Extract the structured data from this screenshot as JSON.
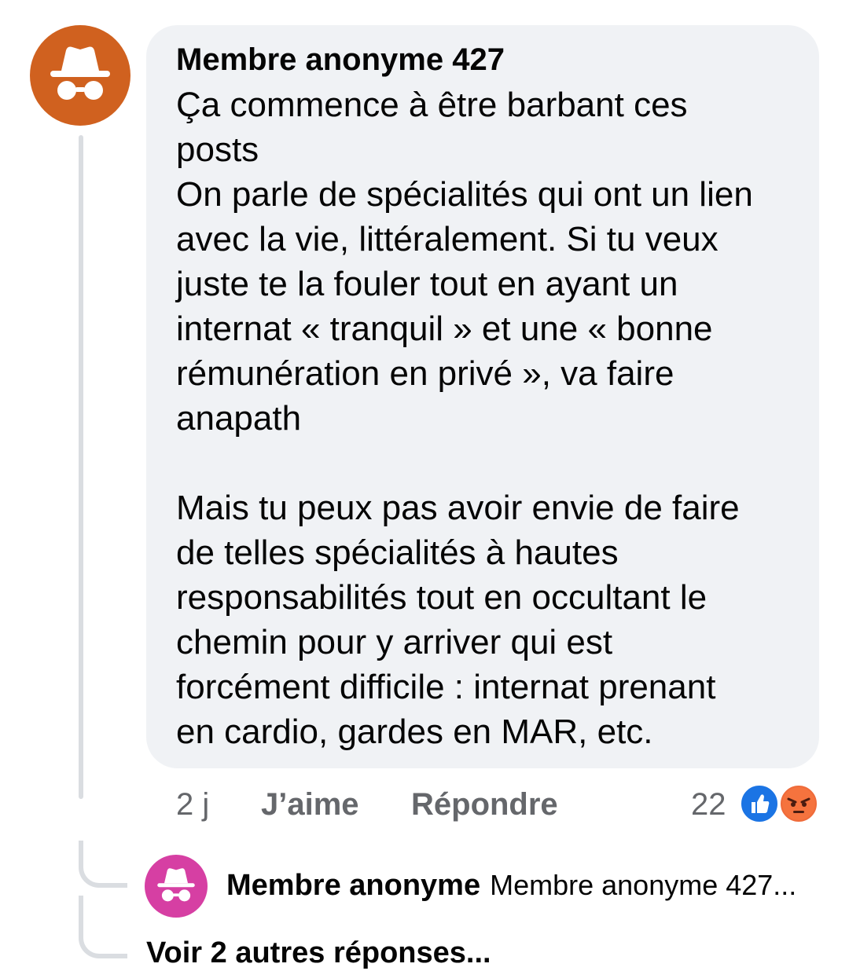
{
  "comment": {
    "author": "Membre anonyme 427",
    "avatar_icon": "incognito-icon",
    "avatar_color": "#d0611f",
    "body": "Ça commence à être barbant ces\nposts\nOn parle de spécialités qui ont un lien\navec la vie, littéralement. Si tu veux\njuste te la fouler tout en ayant un\ninternat « tranquil » et une « bonne\nrémunération en privé », va faire\nanapath\n\nMais tu peux pas avoir envie de faire\nde telles spécialités à hautes\nresponsabilités tout en occultant le\nchemin pour y arriver qui est\nforcément difficile : internat prenant\nen cardio, gardes en MAR, etc.",
    "time": "2 j",
    "like_label": "J’aime",
    "reply_label": "Répondre",
    "reaction_count": "22",
    "reactions": [
      "like-reaction-icon",
      "angry-reaction-icon"
    ]
  },
  "reply": {
    "author": "Membre anonyme",
    "snippet": "Membre anonyme 427...",
    "avatar_icon": "incognito-icon",
    "avatar_color": "#d63fa3"
  },
  "more_replies_label": "Voir 2 autres réponses..."
}
